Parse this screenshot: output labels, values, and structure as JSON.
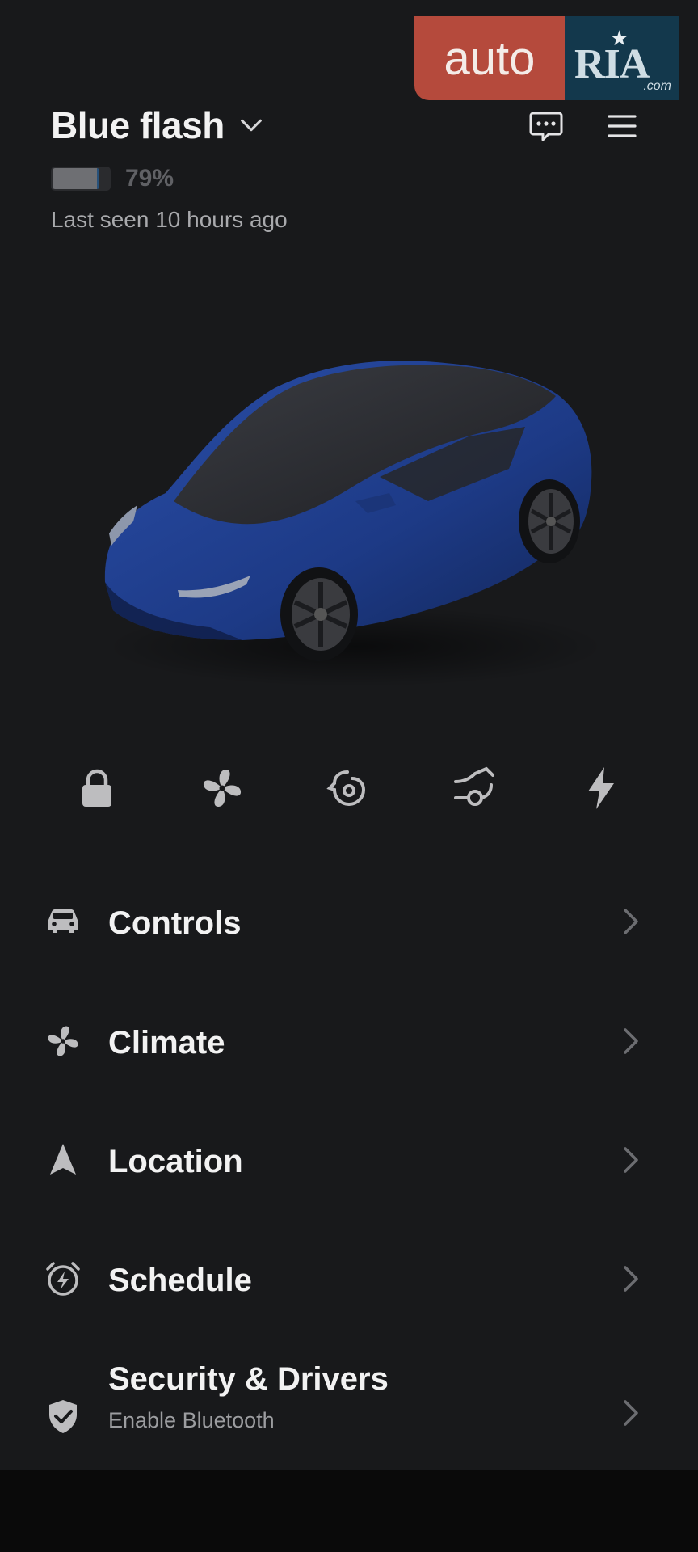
{
  "watermark": {
    "brand_left": "auto",
    "brand_right": "RIA",
    "suffix": ".com"
  },
  "header": {
    "car_name": "Blue flash",
    "battery_percent_value": 79,
    "battery_label": "79%",
    "last_seen": "Last seen 10 hours ago"
  },
  "car": {
    "color": "#1f3b8a",
    "model_icon": "car-render"
  },
  "quick_controls": [
    {
      "icon": "lock-icon"
    },
    {
      "icon": "fan-icon"
    },
    {
      "icon": "frunk-icon"
    },
    {
      "icon": "trunk-icon"
    },
    {
      "icon": "charge-port-icon"
    }
  ],
  "menu": [
    {
      "label": "Controls",
      "icon": "car-icon"
    },
    {
      "label": "Climate",
      "icon": "fan-icon"
    },
    {
      "label": "Location",
      "icon": "location-arrow-icon"
    },
    {
      "label": "Schedule",
      "icon": "alarm-clock-icon"
    },
    {
      "label": "Security & Drivers",
      "sub": "Enable Bluetooth",
      "icon": "shield-check-icon"
    }
  ],
  "colors": {
    "background": "#18191b",
    "text": "#f2f2f2",
    "muted": "#9c9da0",
    "icon": "#bdbdbf",
    "watermark_red": "#b54a3c",
    "watermark_blue": "#13384c"
  }
}
